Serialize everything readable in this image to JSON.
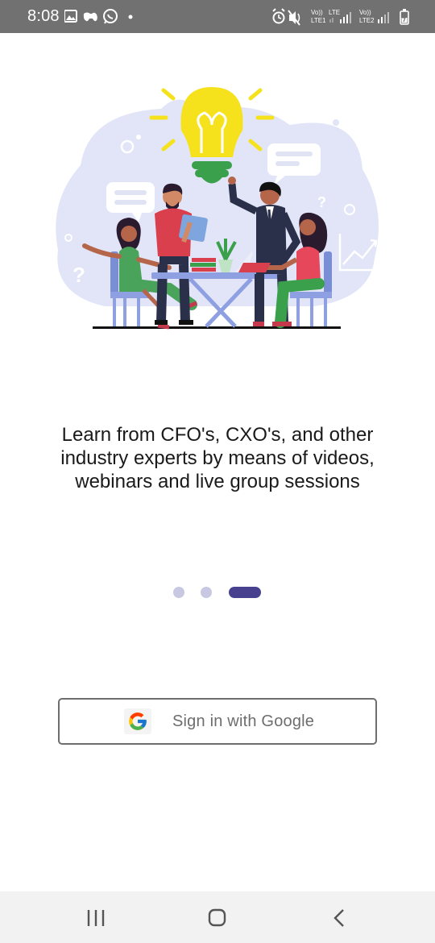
{
  "status_bar": {
    "time": "8:08",
    "left_icons": [
      "image-icon",
      "game-controller-icon",
      "whatsapp-icon",
      "notification-dot-icon"
    ],
    "right_icons": [
      "alarm-icon",
      "mute-icon",
      "volte-lte1-signal-icon",
      "volte-lte2-signal-icon",
      "battery-charging-icon"
    ],
    "sim1_label_top": "Vo))",
    "sim1_label_mid": "LTE",
    "sim1_label_bottom": "LTE1",
    "sim2_label_top": "Vo))",
    "sim2_label_bottom": "LTE2"
  },
  "onboarding": {
    "message": "Learn from CFO's, CXO's, and other industry experts by means of videos, webinars and live group sessions",
    "page_count": 3,
    "active_page": 3,
    "colors": {
      "dot_inactive": "#c9c8e2",
      "dot_active": "#47418f"
    }
  },
  "sign_in": {
    "label": "Sign in with Google",
    "icon": "google-logo-icon"
  },
  "nav_bar": {
    "buttons": [
      "recents-icon",
      "home-icon",
      "back-icon"
    ]
  }
}
